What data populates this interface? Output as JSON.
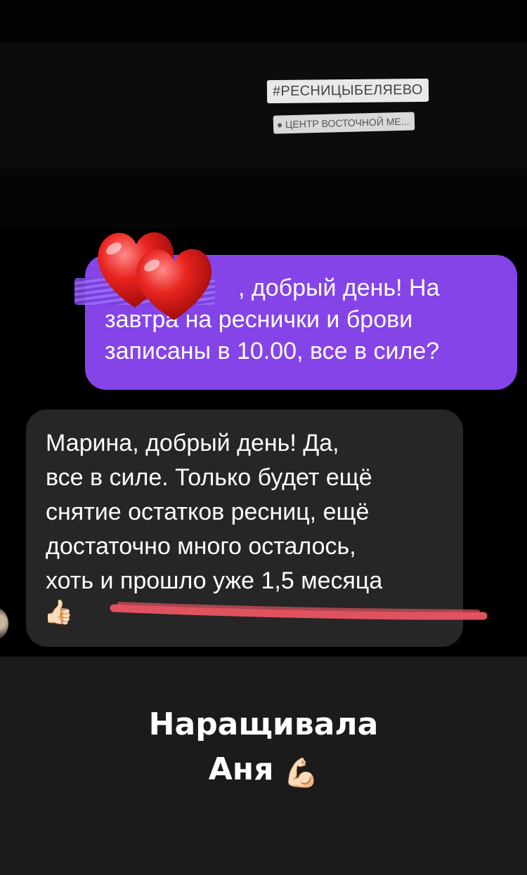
{
  "stickers": {
    "hashtag": "#РЕСНИЦЫБЕЛЯЕВО",
    "location": "ЦЕНТР ВОСТОЧНОЙ МЕ..."
  },
  "messages": {
    "outgoing": {
      "lines": [
        ", добрый день! На",
        "завтра  на реснички и брови",
        "записаны в 10.00, все в силе?"
      ],
      "color": "#8544e8"
    },
    "incoming": {
      "lines": [
        "Марина, добрый день! Да,",
        "все в силе. Только будет ещё",
        "снятие остатков ресниц, ещё",
        "достаточно много осталось,",
        "хоть и прошло уже 1,5 месяца"
      ],
      "reaction": "👍🏻",
      "color": "#262626"
    }
  },
  "decorations": {
    "hearts_icon": "hearts-icon",
    "underline_color": "#e0525f"
  },
  "caption": {
    "line1": "Наращивала",
    "line2": "Аня",
    "emoji": "💪🏻"
  }
}
